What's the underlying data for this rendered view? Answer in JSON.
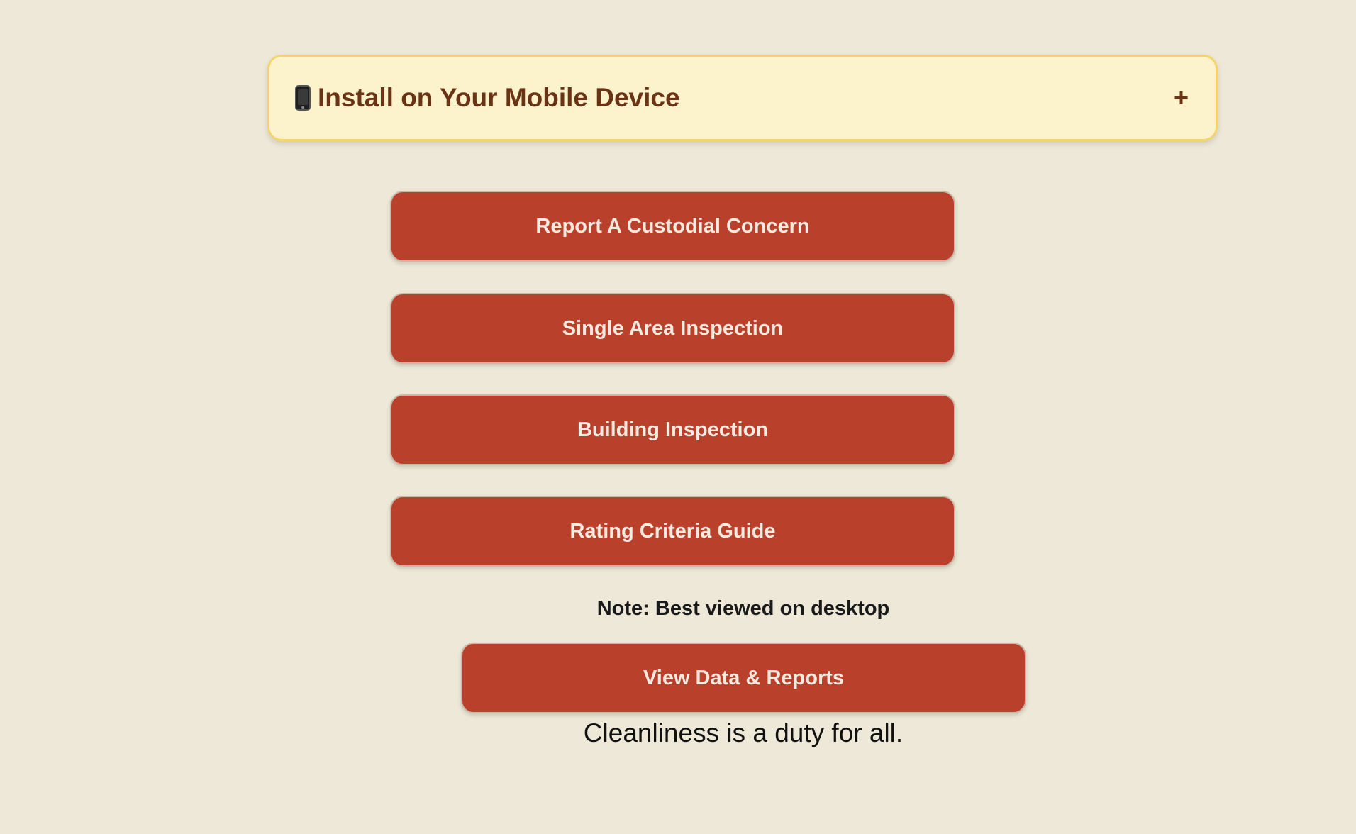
{
  "install_banner": {
    "icon": "mobile-phone-icon",
    "title": "Install on Your Mobile Device",
    "toggle_symbol": "+"
  },
  "actions": [
    {
      "label": "Report A Custodial Concern"
    },
    {
      "label": "Single Area Inspection"
    },
    {
      "label": "Building Inspection"
    },
    {
      "label": "Rating Criteria Guide"
    }
  ],
  "note": "Note: Best viewed on desktop",
  "data_reports": {
    "label": "View Data & Reports"
  },
  "tagline": "Cleanliness is a duty for all.",
  "colors": {
    "background": "#ede8d7",
    "banner_bg": "#fcf3cc",
    "banner_border": "#f5d46c",
    "banner_text": "#6b3315",
    "button_bg": "#b9402b",
    "button_text": "#f6e9df"
  }
}
